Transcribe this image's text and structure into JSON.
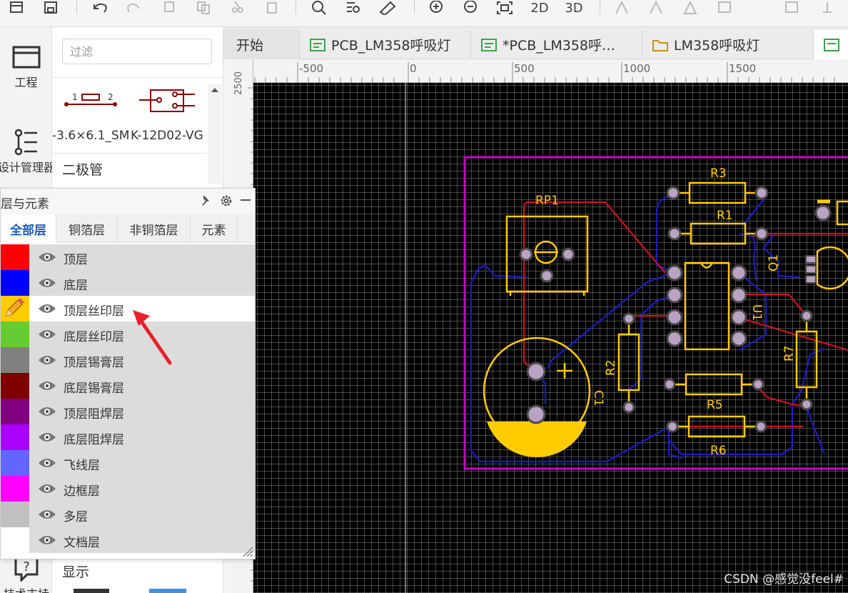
{
  "toolbar": {
    "items": [
      "file-icon",
      "save-icon",
      "undo-icon",
      "redo-icon",
      "copy-icon",
      "paste-icon",
      "cut-icon",
      "delete-icon",
      "search-icon",
      "find-list-icon",
      "measure-icon",
      "zoom-in-icon",
      "zoom-out-icon",
      "fit-view-icon",
      "align-icon"
    ],
    "view_2d": "2D",
    "view_3d": "3D"
  },
  "leftstrip": {
    "project_label": "工程",
    "design_manager_label": "设计管理器",
    "support_label": "技术支持"
  },
  "library": {
    "filter_placeholder": "过滤",
    "parts": [
      "-3.6×6.1_SM",
      "K-12D02-VG"
    ],
    "category_diode": "二极管",
    "display_label": "显示"
  },
  "tabs": [
    {
      "label": "开始",
      "icon": ""
    },
    {
      "label": "PCB_LM358呼吸灯",
      "icon": "pcb-icon"
    },
    {
      "label": "*PCB_LM358呼…",
      "icon": "pcb-icon"
    },
    {
      "label": "LM358呼吸灯",
      "icon": "folder-icon"
    }
  ],
  "ruler": {
    "h_labels": [
      "-500",
      "0",
      "500",
      "1000",
      "1500"
    ],
    "v_labels": [
      "2500"
    ]
  },
  "pcb": {
    "labels": [
      "R3",
      "R1",
      "RP1",
      "Q1",
      "U1",
      "R2",
      "C1",
      "R7",
      "R5",
      "R6"
    ]
  },
  "layer_panel": {
    "title": "层与元素",
    "tabs": [
      "全部层",
      "铜箔层",
      "非铜箔层",
      "元素"
    ],
    "active_tab": "全部层",
    "layers": [
      {
        "name": "顶层",
        "color": "#ff0000"
      },
      {
        "name": "底层",
        "color": "#0000ff"
      },
      {
        "name": "顶层丝印层",
        "color": "#ffcc00",
        "active": true
      },
      {
        "name": "底层丝印层",
        "color": "#66cc33"
      },
      {
        "name": "顶层锡膏层",
        "color": "#808080"
      },
      {
        "name": "底层锡膏层",
        "color": "#800000"
      },
      {
        "name": "顶层阻焊层",
        "color": "#800080"
      },
      {
        "name": "底层阻焊层",
        "color": "#aa00ff"
      },
      {
        "name": "飞线层",
        "color": "#6464ff"
      },
      {
        "name": "边框层",
        "color": "#ff00ff"
      },
      {
        "name": "多层",
        "color": "#c0c0c0"
      },
      {
        "name": "文档层",
        "color": "#ffffff"
      }
    ]
  },
  "watermark": "CSDN @感觉没feel#"
}
